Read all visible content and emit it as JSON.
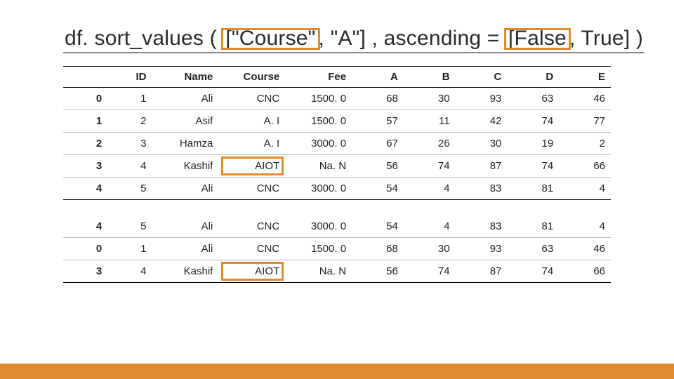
{
  "title": {
    "t1": "df. sort_values ( ",
    "hl1": "[\"Course\"",
    "t2": ", \"A\"] , ascending = ",
    "hl2": "[False",
    "t3": ", True] )"
  },
  "chart_data": [
    {
      "type": "table",
      "headers": [
        "",
        "ID",
        "Name",
        "Course",
        "Fee",
        "A",
        "B",
        "C",
        "D",
        "E"
      ],
      "rows": [
        {
          "idx": "0",
          "id": "1",
          "name": "Ali",
          "course": "CNC",
          "fee": "1500. 0",
          "a": "68",
          "b": "30",
          "c": "93",
          "d": "63",
          "e": "46"
        },
        {
          "idx": "1",
          "id": "2",
          "name": "Asif",
          "course": "A. I",
          "fee": "1500. 0",
          "a": "57",
          "b": "11",
          "c": "42",
          "d": "74",
          "e": "77"
        },
        {
          "idx": "2",
          "id": "3",
          "name": "Hamza",
          "course": "A. I",
          "fee": "3000. 0",
          "a": "67",
          "b": "26",
          "c": "30",
          "d": "19",
          "e": "2"
        },
        {
          "idx": "3",
          "id": "4",
          "name": "Kashif",
          "course": "AIOT",
          "fee": "Na. N",
          "a": "56",
          "b": "74",
          "c": "87",
          "d": "74",
          "e": "66"
        },
        {
          "idx": "4",
          "id": "5",
          "name": "Ali",
          "course": "CNC",
          "fee": "3000. 0",
          "a": "54",
          "b": "4",
          "c": "83",
          "d": "81",
          "e": "4"
        }
      ]
    },
    {
      "type": "table",
      "rows": [
        {
          "idx": "4",
          "id": "5",
          "name": "Ali",
          "course": "CNC",
          "fee": "3000. 0",
          "a": "54",
          "b": "4",
          "c": "83",
          "d": "81",
          "e": "4"
        },
        {
          "idx": "0",
          "id": "1",
          "name": "Ali",
          "course": "CNC",
          "fee": "1500. 0",
          "a": "68",
          "b": "30",
          "c": "93",
          "d": "63",
          "e": "46"
        },
        {
          "idx": "3",
          "id": "4",
          "name": "Kashif",
          "course": "AIOT",
          "fee": "Na. N",
          "a": "56",
          "b": "74",
          "c": "87",
          "d": "74",
          "e": "66"
        }
      ]
    }
  ],
  "highlight_course": "AIOT"
}
